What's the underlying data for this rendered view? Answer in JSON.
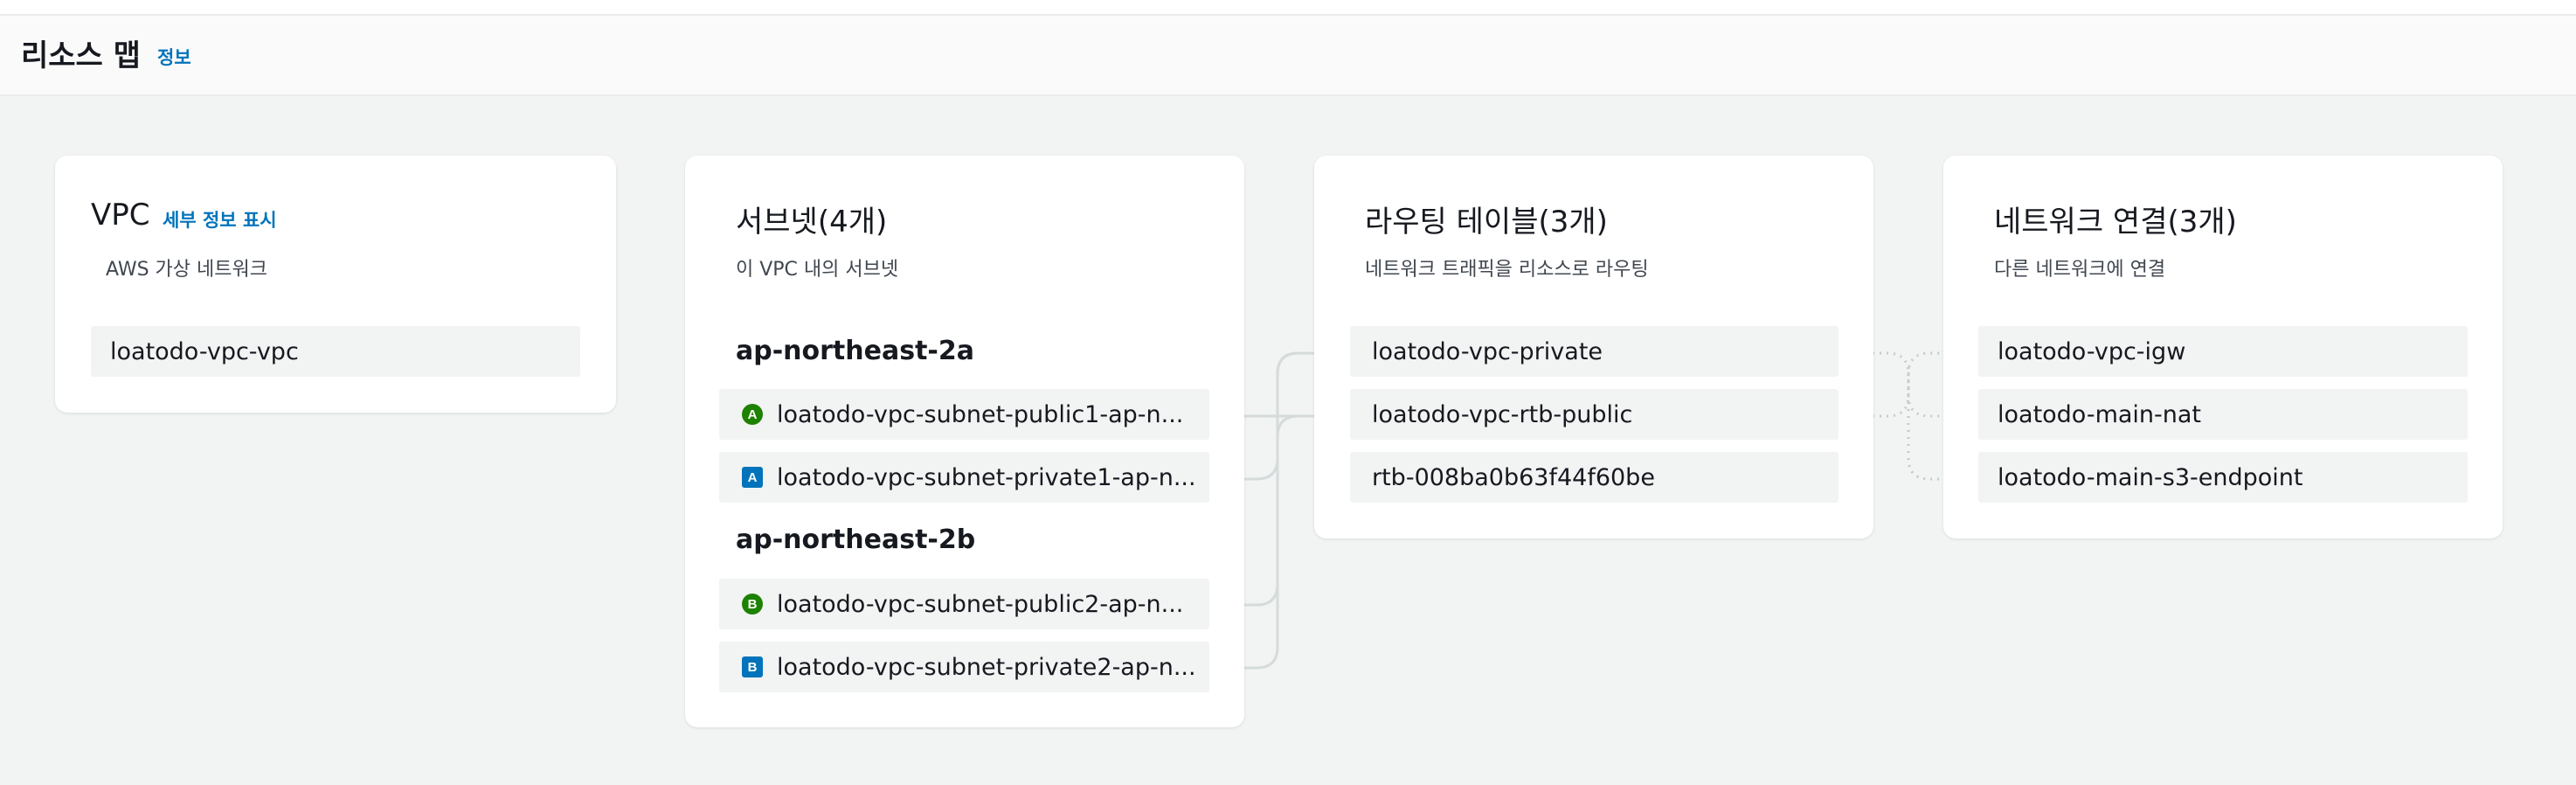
{
  "header": {
    "title": "리소스 맵",
    "info_link": "정보"
  },
  "vpc": {
    "title": "VPC",
    "details_link": "세부 정보 표시",
    "description": "AWS 가상 네트워크",
    "items": [
      "loatodo-vpc-vpc"
    ]
  },
  "subnets": {
    "title": "서브넷(4개)",
    "description": "이 VPC 내의 서브넷",
    "zones": [
      {
        "name": "ap-northeast-2a",
        "items": [
          {
            "label": "loatodo-vpc-subnet-public1-ap-n...",
            "badge": "A",
            "type": "public"
          },
          {
            "label": "loatodo-vpc-subnet-private1-ap-n...",
            "badge": "A",
            "type": "private"
          }
        ]
      },
      {
        "name": "ap-northeast-2b",
        "items": [
          {
            "label": "loatodo-vpc-subnet-public2-ap-n...",
            "badge": "B",
            "type": "public"
          },
          {
            "label": "loatodo-vpc-subnet-private2-ap-n...",
            "badge": "B",
            "type": "private"
          }
        ]
      }
    ]
  },
  "route_tables": {
    "title": "라우팅 테이블(3개)",
    "description": "네트워크 트래픽을 리소스로 라우팅",
    "items": [
      "loatodo-vpc-private",
      "loatodo-vpc-rtb-public",
      "rtb-008ba0b63f44f60be"
    ]
  },
  "network_connections": {
    "title": "네트워크 연결(3개)",
    "description": "다른 네트워크에 연결",
    "items": [
      "loatodo-vpc-igw",
      "loatodo-main-nat",
      "loatodo-main-s3-endpoint"
    ]
  },
  "colors": {
    "public_badge": "#1d8102",
    "private_badge": "#0073bb",
    "link": "#0073bb",
    "connector": "#d5dbdb"
  }
}
